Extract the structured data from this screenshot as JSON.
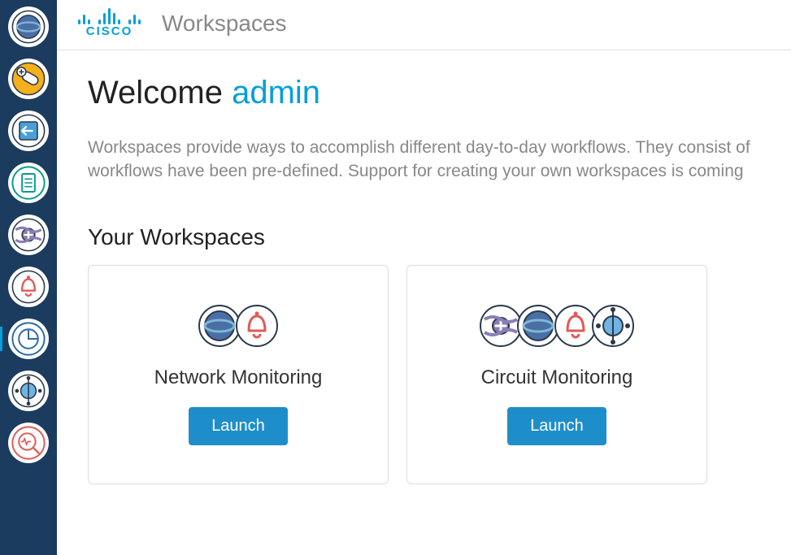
{
  "brand": "CISCO",
  "header_title": "Workspaces",
  "welcome_prefix": "Welcome ",
  "username": "admin",
  "description_line1": "Workspaces provide ways to accomplish different day-to-day workflows. They consist of",
  "description_line2": "workflows have been pre-defined. Support for creating your own workspaces is coming ",
  "section_title": "Your Workspaces",
  "sidebar": {
    "items": [
      {
        "name": "globe-icon"
      },
      {
        "name": "add-pill-icon"
      },
      {
        "name": "import-icon"
      },
      {
        "name": "document-icon"
      },
      {
        "name": "add-circuit-icon"
      },
      {
        "name": "bell-icon"
      },
      {
        "name": "chart-icon"
      },
      {
        "name": "topology-icon"
      },
      {
        "name": "search-pulse-icon"
      }
    ],
    "active_index": 6
  },
  "cards": [
    {
      "title": "Network Monitoring",
      "launch_label": "Launch",
      "icons": [
        "globe",
        "bell"
      ]
    },
    {
      "title": "Circuit Monitoring",
      "launch_label": "Launch",
      "icons": [
        "add-circuit",
        "globe",
        "bell",
        "topology"
      ]
    }
  ]
}
